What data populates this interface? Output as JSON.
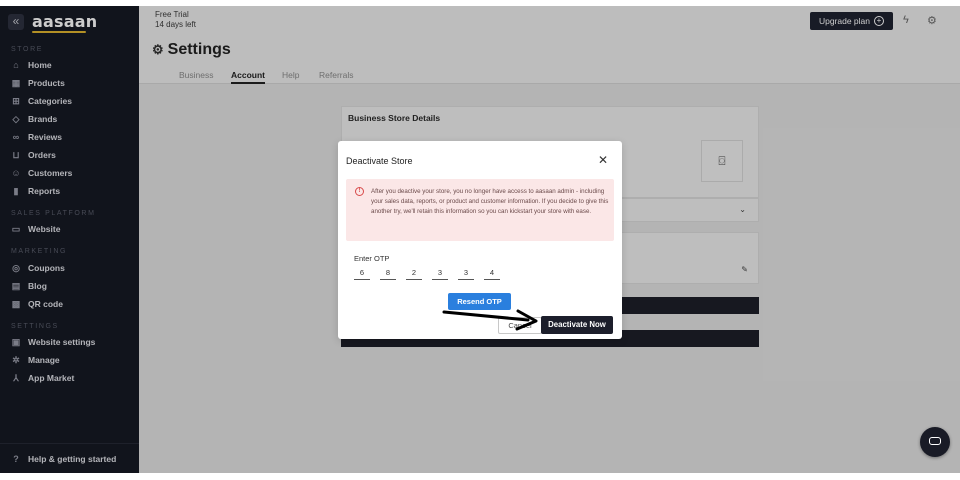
{
  "sidebar": {
    "logo": "aasaan",
    "collapse_icon": "«",
    "sections": {
      "store": "STORE",
      "sales_platform": "SALES PLATFORM",
      "marketing": "MARKETING",
      "settings": "SETTINGS"
    },
    "store_items": [
      "Home",
      "Products",
      "Categories",
      "Brands",
      "Reviews",
      "Orders",
      "Customers",
      "Reports"
    ],
    "sales_items": [
      "Website"
    ],
    "marketing_items": [
      "Coupons",
      "Blog",
      "QR code"
    ],
    "settings_items": [
      "Website settings",
      "Manage",
      "App Market"
    ],
    "help": "Help & getting started"
  },
  "topbar": {
    "trial_title": "Free Trial",
    "trial_days": "14 days left",
    "upgrade_label": "Upgrade plan"
  },
  "page": {
    "title": "Settings",
    "tabs": [
      "Business",
      "Account",
      "Help",
      "Referrals"
    ],
    "active_tab": "Account",
    "card_title": "Business Store Details"
  },
  "modal": {
    "title": "Deactivate Store",
    "warning": "After you deactive your store, you no longer have access to aasaan admin - including your sales data, reports, or product and customer information. If you decide to give this another try, we'll retain this information so you can kickstart your store with ease.",
    "otp_label": "Enter OTP",
    "otp": [
      "6",
      "8",
      "2",
      "3",
      "3",
      "4"
    ],
    "resend_label": "Resend OTP",
    "cancel_label": "Cancel",
    "deactivate_label": "Deactivate Now"
  },
  "colors": {
    "sidebar_bg": "#161923",
    "primary_dark": "#1c1e2b",
    "resend_blue": "#2a7fde",
    "alert_bg": "#fbe7e7",
    "logo_accent": "#e0b42f"
  }
}
